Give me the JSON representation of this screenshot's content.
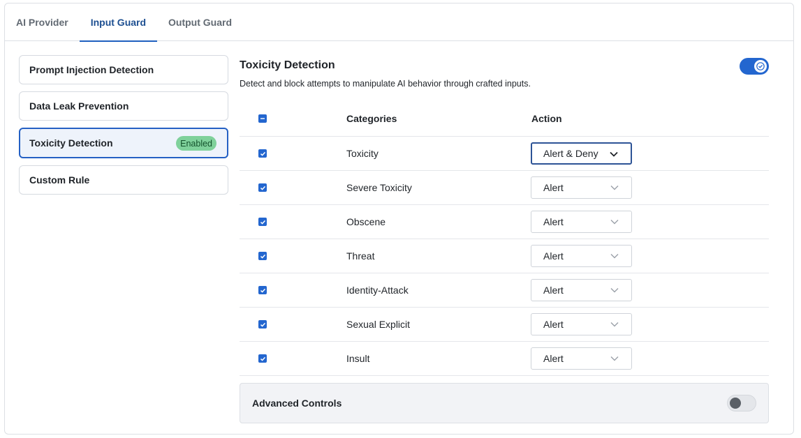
{
  "tabs": [
    {
      "label": "AI Provider",
      "active": false
    },
    {
      "label": "Input Guard",
      "active": true
    },
    {
      "label": "Output Guard",
      "active": false
    }
  ],
  "sidebar": {
    "items": [
      {
        "label": "Prompt Injection Detection"
      },
      {
        "label": "Data Leak Prevention"
      },
      {
        "label": "Toxicity Detection",
        "badge": "Enabled",
        "active": true
      },
      {
        "label": "Custom Rule"
      }
    ]
  },
  "detail": {
    "title": "Toxicity Detection",
    "description": "Detect and block attempts to manipulate AI behavior through crafted inputs.",
    "enabled": true
  },
  "table": {
    "headers": {
      "categories": "Categories",
      "action": "Action"
    },
    "rows": [
      {
        "category": "Toxicity",
        "action": "Alert & Deny",
        "checked": true
      },
      {
        "category": "Severe Toxicity",
        "action": "Alert",
        "checked": true
      },
      {
        "category": "Obscene",
        "action": "Alert",
        "checked": true
      },
      {
        "category": "Threat",
        "action": "Alert",
        "checked": true
      },
      {
        "category": "Identity-Attack",
        "action": "Alert",
        "checked": true
      },
      {
        "category": "Sexual Explicit",
        "action": "Alert",
        "checked": true
      },
      {
        "category": "Insult",
        "action": "Alert",
        "checked": true
      }
    ]
  },
  "advanced": {
    "label": "Advanced Controls",
    "enabled": false
  },
  "colors": {
    "accent": "#2366cf",
    "badge_bg": "#7fd19b",
    "tab_active": "#1d4f91"
  }
}
